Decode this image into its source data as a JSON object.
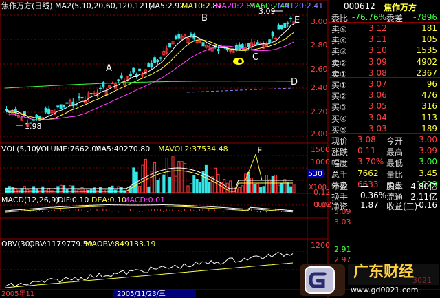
{
  "chart_title": "焦作万方(日线)",
  "price_ma": {
    "label": "MA2(5,10,20,60,120,121)",
    "ma5": "MA5:2.92",
    "ma10": "MA10:2.87",
    "ma20": "MA20:2.85",
    "ma60": "MA60:2.49",
    "ma120": "MA120:2.41"
  },
  "price_axis": [
    "3.00",
    "2.80",
    "2.60",
    "2.40",
    "2.20",
    "2.00"
  ],
  "price_high": "3.09",
  "price_low": "1.98",
  "annotations": {
    "a": "A",
    "b": "B",
    "c": "C",
    "d": "D",
    "e": "E",
    "f": "F"
  },
  "volume": {
    "label": "VOL(5,10)",
    "value": "VOLUME:7662.00",
    "ma5": "MA5:40270.80",
    "mavol2": "MAVOL2:37534.48",
    "axis": [
      "1500",
      "1000",
      "500",
      "X100"
    ],
    "marker": "530"
  },
  "macd": {
    "label": "MACD(12,26,9)",
    "dif": "DIF:0.10",
    "dea": "DEA:0.10",
    "macd": "MACD:0.01",
    "axis": [
      "0.12",
      "0.07",
      "0.02"
    ],
    "right": [
      "3.09",
      "3.03"
    ]
  },
  "obv": {
    "label": "OBV(30)",
    "obv": "OBV:1179779.50",
    "maobv": "MAOBV:849133.19",
    "axis": [
      "1200",
      "600"
    ],
    "right": [
      "2.91",
      "2.97",
      "3021"
    ]
  },
  "date_bar": {
    "left": "2005年11",
    "center": "2005/11/23/三"
  },
  "quote": {
    "code": "000612",
    "name": "焦作万方",
    "weibi_label": "委比",
    "weibi_value": "-76.76%",
    "weicha_label": "委差",
    "weicha_value": "-7896",
    "sell": [
      {
        "label": "卖⑤",
        "price": "3.12",
        "vol": "181"
      },
      {
        "label": "卖④",
        "price": "3.11",
        "vol": "105"
      },
      {
        "label": "卖③",
        "price": "3.10",
        "vol": "1535"
      },
      {
        "label": "卖②",
        "price": "3.09",
        "vol": "4902"
      },
      {
        "label": "卖①",
        "price": "3.08",
        "vol": "2367"
      }
    ],
    "buy": [
      {
        "label": "买①",
        "price": "3.07",
        "vol": "96"
      },
      {
        "label": "买②",
        "price": "3.06",
        "vol": "476"
      },
      {
        "label": "买③",
        "price": "3.05",
        "vol": "316"
      },
      {
        "label": "买④",
        "price": "3.04",
        "vol": "113"
      },
      {
        "label": "买⑤",
        "price": "3.03",
        "vol": "189"
      }
    ],
    "stats": [
      {
        "l1": "现价",
        "v1": "3.08",
        "l2": "今开",
        "v2": "3.00"
      },
      {
        "l1": "涨跌",
        "v1": "0.11",
        "l2": "最高",
        "v2": "3.09"
      },
      {
        "l1": "幅度",
        "v1": "3.70%",
        "l2": "最低",
        "v2": "3.00"
      },
      {
        "l1": "总手",
        "v1": "7662",
        "l2": "量比",
        "v2": "3.45"
      },
      {
        "l1": "外盘",
        "v1": "6633",
        "l2": "内盘",
        "v2": "1029"
      }
    ],
    "fund": [
      {
        "l1": "市盈",
        "v1": "一",
        "l2": "股本",
        "v2": "4.80亿"
      },
      {
        "l1": "换手",
        "v1": "0.36%",
        "l2": "流通",
        "v2": "2.11亿"
      },
      {
        "l1": "净资",
        "v1": "1.87",
        "l2": "收益(三)",
        "v2": "-0.16"
      }
    ]
  },
  "watermark": {
    "brand": "广东财经",
    "url": "www.gd0021.com"
  },
  "colors": {
    "up": "#ff3b3b",
    "down": "#35e6e6",
    "ma5": "#ffffff",
    "ma10": "#ffff40",
    "ma20": "#ff40ff",
    "ma60": "#40ff40",
    "ma120": "#8080ff",
    "grid": "#8b0000"
  }
}
